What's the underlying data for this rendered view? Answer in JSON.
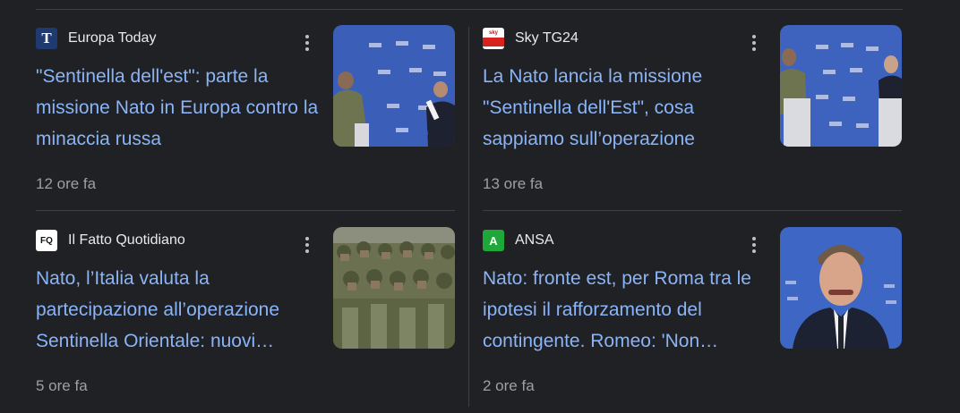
{
  "stories": [
    {
      "source": "Europa Today",
      "logo_text": "T",
      "headline": "\"Sentinella dell'est\": parte la missione Nato in Europa contro la minaccia russa",
      "time": "12 ore fa"
    },
    {
      "source": "Sky TG24",
      "logo_text": "sky",
      "headline": "La Nato lancia la missione \"Sentinella dell'Est\", cosa sappiamo sull’operazione",
      "time": "13 ore fa"
    },
    {
      "source": "Il Fatto Quotidiano",
      "logo_text": "FQ",
      "headline": "Nato, l’Italia valuta la partecipazione all’operazione Sentinella Orientale: nuovi…",
      "time": "5 ore fa"
    },
    {
      "source": "ANSA",
      "logo_text": "A",
      "headline": "Nato: fronte est, per Roma tra le ipotesi il rafforzamento del contingente. Romeo: 'Non…",
      "time": "2 ore fa"
    }
  ],
  "colors": {
    "background": "#202124",
    "headline": "#8ab4f8",
    "source": "#e8eaed",
    "time": "#9aa0a6"
  }
}
